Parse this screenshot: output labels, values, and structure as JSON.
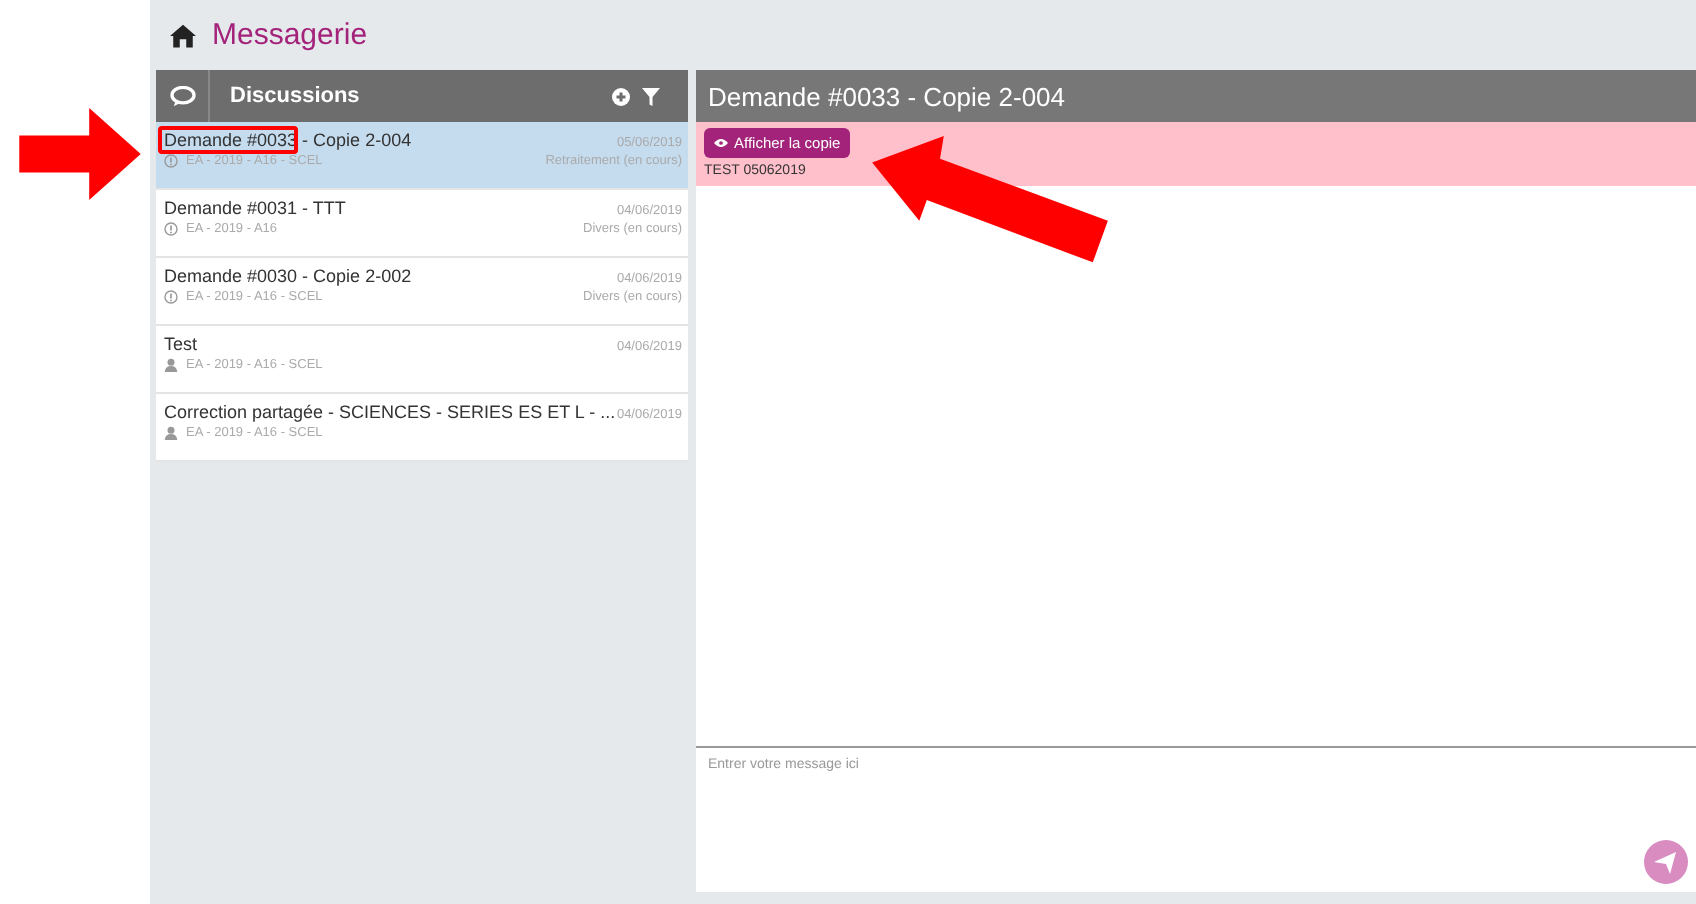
{
  "page_title": "Messagerie",
  "discussions": {
    "title": "Discussions",
    "items": [
      {
        "title": "Demande #0033 - Copie 2-004",
        "date": "05/06/2019",
        "meta": "EA - 2019 - A16 - SCEL",
        "status": "Retraitement (en cours)",
        "kind": "request",
        "selected": true,
        "highlighted": true
      },
      {
        "title": "Demande #0031 - TTT",
        "date": "04/06/2019",
        "meta": "EA - 2019 - A16",
        "status": "Divers (en cours)",
        "kind": "request",
        "selected": false,
        "highlighted": false
      },
      {
        "title": "Demande #0030 - Copie 2-002",
        "date": "04/06/2019",
        "meta": "EA - 2019 - A16 - SCEL",
        "status": "Divers (en cours)",
        "kind": "request",
        "selected": false,
        "highlighted": false
      },
      {
        "title": "Test",
        "date": "04/06/2019",
        "meta": "EA - 2019 - A16 - SCEL",
        "kind": "user",
        "selected": false,
        "highlighted": false
      },
      {
        "title": "Correction partagée - SCIENCES - SERIES ES ET L - ...",
        "date": "04/06/2019",
        "meta": "EA - 2019 - A16 - SCEL",
        "kind": "user",
        "selected": false,
        "highlighted": false
      }
    ]
  },
  "conversation": {
    "title": "Demande #0033 - Copie 2-004",
    "button": "Afficher la copie",
    "message": "TEST 05062019",
    "input_placeholder": "Entrer votre message ici"
  }
}
